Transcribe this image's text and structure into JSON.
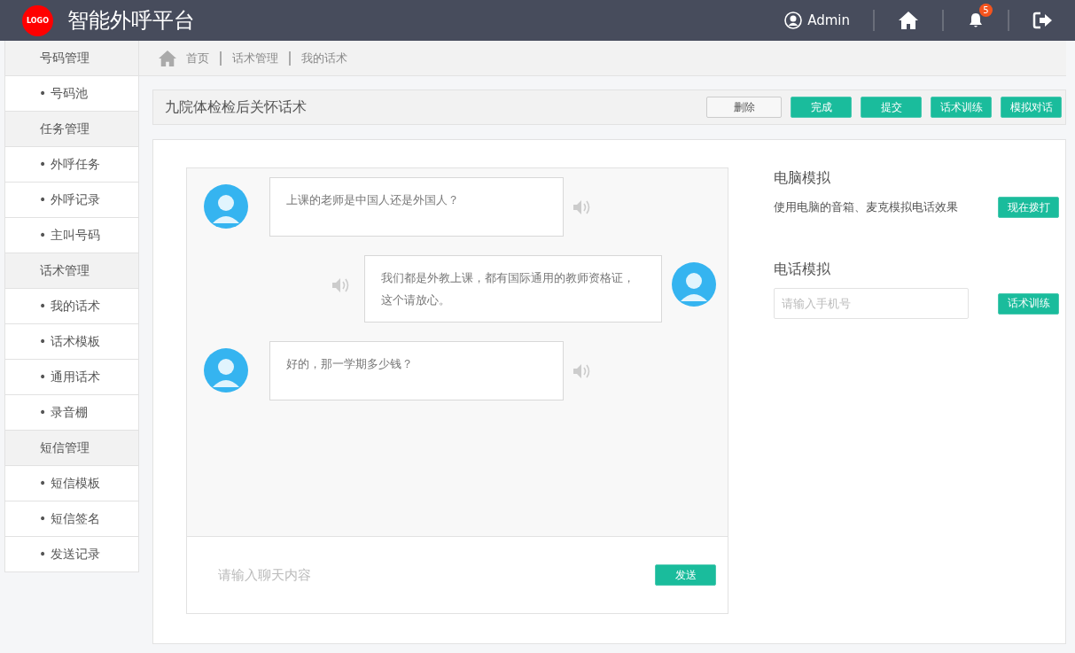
{
  "header": {
    "logo": "LOGO",
    "title": "智能外呼平台",
    "user": "Admin",
    "notifications": "5"
  },
  "sidebar": [
    {
      "label": "号码管理",
      "children": [
        "• 号码池"
      ]
    },
    {
      "label": "任务管理",
      "children": [
        "• 外呼任务",
        "• 外呼记录",
        "• 主叫号码"
      ]
    },
    {
      "label": "话术管理",
      "children": [
        "• 我的话术",
        "• 话术模板",
        "• 通用话术",
        "• 录音棚"
      ]
    },
    {
      "label": "短信管理",
      "children": [
        "• 短信模板",
        "• 短信签名",
        "• 发送记录"
      ]
    }
  ],
  "breadcrumb": [
    "首页",
    "话术管理",
    "我的话术"
  ],
  "script_title": "九院体检检后关怀话术",
  "actions": [
    {
      "label": "删除",
      "kind": "plain"
    },
    {
      "label": "完成",
      "kind": "primary"
    },
    {
      "label": "提交",
      "kind": "primary"
    },
    {
      "label": "话术训练",
      "kind": "primary"
    },
    {
      "label": "模拟对话",
      "kind": "primary"
    }
  ],
  "messages": [
    {
      "kind": "incoming",
      "text": "上课的老师是中国人还是外国人？"
    },
    {
      "kind": "outgoing",
      "text": "我们都是外教上课，都有国际通用的教师资格证，这个请放心。"
    },
    {
      "kind": "incoming",
      "text": "好的，那一学期多少钱？"
    }
  ],
  "chat_input": {
    "placeholder": "请输入聊天内容"
  },
  "send_button": "发送",
  "pc_sim": {
    "title": "电脑模拟",
    "description": "使用电脑的音箱、麦克模拟电话效果",
    "button": "现在拨打"
  },
  "phone_sim": {
    "title": "电话模拟",
    "placeholder": "请输入手机号",
    "button": "话术训练"
  }
}
